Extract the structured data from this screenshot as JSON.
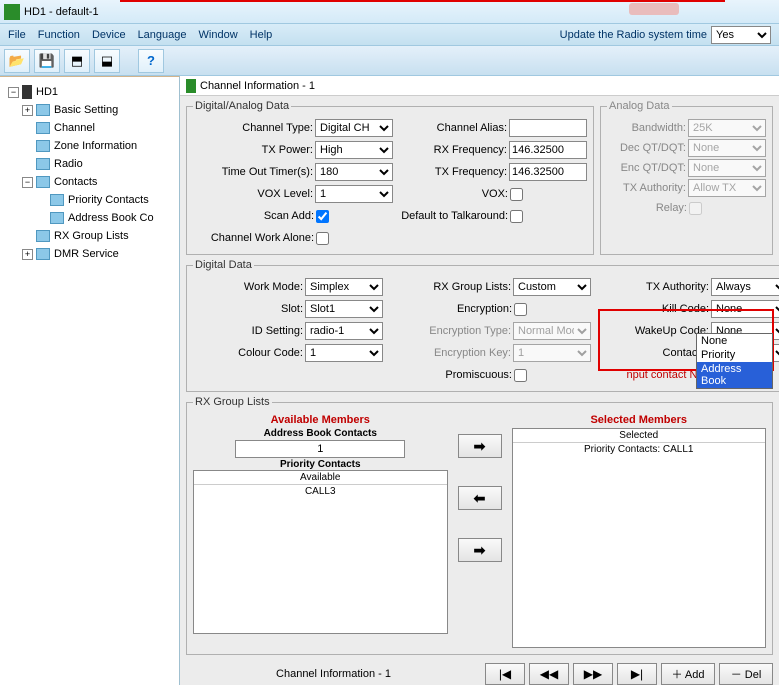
{
  "title": "HD1  -  default-1",
  "menubar": {
    "file": "File",
    "function": "Function",
    "device": "Device",
    "language": "Language",
    "window": "Window",
    "help": "Help",
    "update_label": "Update the Radio system time",
    "update_value": "Yes"
  },
  "tree": {
    "root": "HD1",
    "basic_setting": "Basic Setting",
    "channel": "Channel",
    "zone_info": "Zone Information",
    "radio": "Radio",
    "contacts": "Contacts",
    "priority_contacts": "Priority Contacts",
    "address_book": "Address Book Co",
    "rx_group_lists": "RX Group Lists",
    "dmr_service": "DMR Service"
  },
  "content_title": "Channel Information - 1",
  "digital_analog": {
    "legend": "Digital/Analog Data",
    "channel_type_label": "Channel Type:",
    "channel_type": "Digital CH",
    "tx_power_label": "TX Power:",
    "tx_power": "High",
    "timeout_label": "Time Out Timer(s):",
    "timeout": "180",
    "vox_label": "VOX Level:",
    "vox": "1",
    "scan_add_label": "Scan Add:",
    "work_alone_label": "Channel Work Alone:",
    "channel_alias_label": "Channel Alias:",
    "channel_alias": "",
    "rx_freq_label": "RX Frequency:",
    "rx_freq": "146.32500",
    "tx_freq_label": "TX Frequency:",
    "tx_freq": "146.32500",
    "vox_on_label": "VOX:",
    "talkaround_label": "Default to Talkaround:"
  },
  "analog": {
    "legend": "Analog Data",
    "bandwidth_label": "Bandwidth:",
    "bandwidth": "25K",
    "dec_label": "Dec QT/DQT:",
    "dec": "None",
    "enc_label": "Enc QT/DQT:",
    "enc": "None",
    "txauth_label": "TX Authority:",
    "txauth": "Allow TX",
    "relay_label": "Relay:"
  },
  "digital": {
    "legend": "Digital Data",
    "work_mode_label": "Work Mode:",
    "work_mode": "Simplex",
    "slot_label": "Slot:",
    "slot": "Slot1",
    "id_setting_label": "ID Setting:",
    "id_setting": "radio-1",
    "colour_label": "Colour Code:",
    "colour": "1",
    "rx_group_label": "RX Group Lists:",
    "rx_group": "Custom",
    "encryption_label": "Encryption:",
    "enc_type_label": "Encryption Type:",
    "enc_type": "Normal Mod",
    "enc_key_label": "Encryption Key:",
    "enc_key": "1",
    "promiscuous_label": "Promiscuous:",
    "tx_auth_label": "TX Authority:",
    "tx_auth": "Always",
    "kill_label": "Kill Code:",
    "kill": "None",
    "wakeup_label": "WakeUp Code:",
    "wakeup": "None",
    "contacts_label": "Contacts:",
    "contacts": "Address Bo",
    "input_contact_label": "nput contact NO:",
    "dropdown": {
      "none": "None",
      "priority": "Priority",
      "address_book": "Address Book"
    }
  },
  "rxgroup": {
    "legend": "RX Group Lists",
    "available_title": "Available Members",
    "selected_title": "Selected Members",
    "addr_book_label": "Address Book Contacts",
    "addr_book_value": "1",
    "priority_label": "Priority Contacts",
    "available_hdr": "Available",
    "call3": "CALL3",
    "selected_hdr": "Selected",
    "selected_item": "Priority Contacts: CALL1"
  },
  "nav": {
    "status": "Channel Information - 1",
    "first": "|◀",
    "prev": "◀◀",
    "next": "▶▶",
    "last": "▶|",
    "add": "＋ Add",
    "del": "－ Del"
  }
}
